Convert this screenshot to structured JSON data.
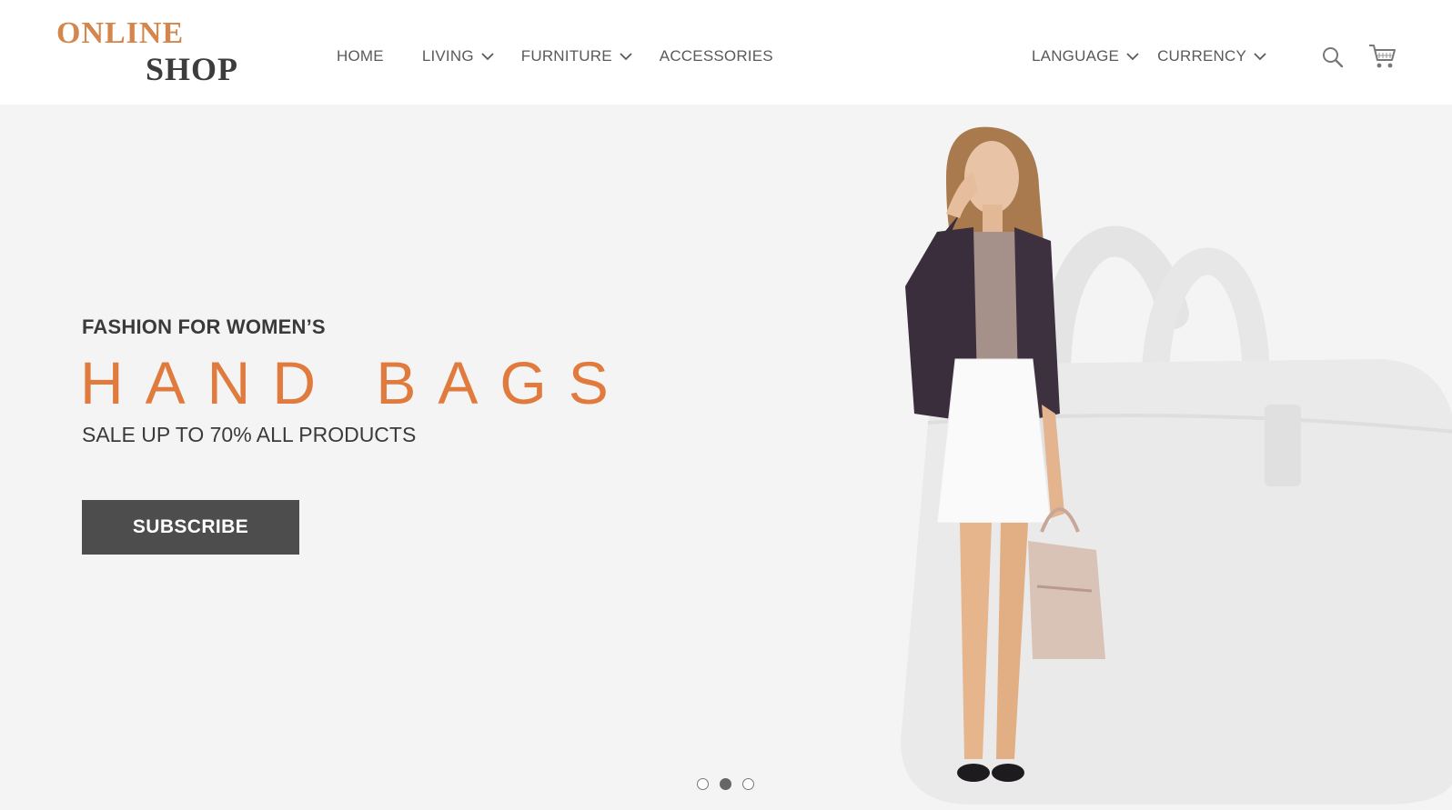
{
  "logo": {
    "line1": "ONLINE",
    "line2": "SHOP"
  },
  "nav": {
    "home": "HOME",
    "living": "LIVING",
    "furniture": "FURNITURE",
    "accessories": "ACCESSORIES",
    "language": "LANGUAGE",
    "currency": "CURRENCY"
  },
  "icons": {
    "search": "search-icon",
    "cart": "cart-icon",
    "dropdown": "chevron-down-icon"
  },
  "hero": {
    "subtitle": "FASHION FOR WOMEN’S",
    "headline": "HAND BAGS",
    "tagline": "SALE UP TO 70% ALL PRODUCTS",
    "cta": "SUBSCRIBE",
    "slides": 3,
    "active_slide": 2
  },
  "colors": {
    "accent": "#e07a3d",
    "logo_accent": "#d4864c",
    "dark": "#4d4d4d",
    "hero_bg": "#f4f4f4"
  }
}
